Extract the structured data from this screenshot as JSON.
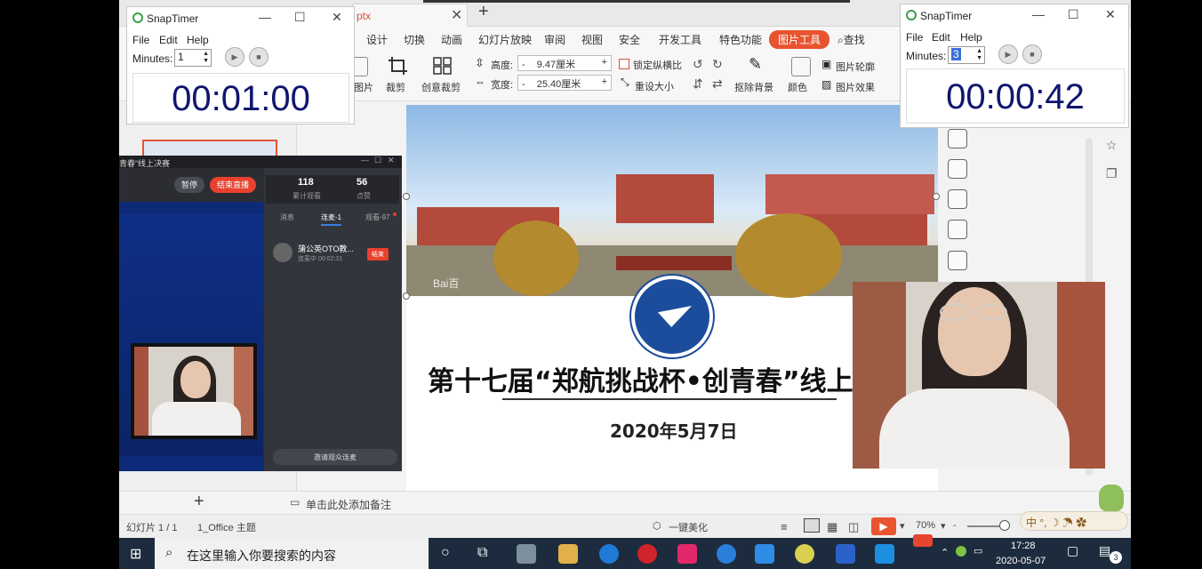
{
  "document_tab": {
    "title": "ptx",
    "add": "+"
  },
  "menu": {
    "items": [
      "设计",
      "切换",
      "动画",
      "幻灯片放映",
      "审阅",
      "视图",
      "安全",
      "开发工具",
      "特色功能"
    ],
    "active": "图片工具",
    "search": "查找"
  },
  "toolbar": {
    "image_label": "图片",
    "crop_label": "裁剪",
    "creative_crop_label": "创意裁剪",
    "height_label": "高度:",
    "height_value": "9.47厘米",
    "width_label": "宽度:",
    "width_value": "25.40厘米",
    "lock_ratio_label": "锁定纵横比",
    "reset_size_label": "重设大小",
    "remove_bg_label": "抠除背景",
    "color_label": "颜色",
    "outline_label": "图片轮廓",
    "effect_label": "图片效果",
    "minus": "-",
    "plus": "+"
  },
  "slide": {
    "title": "第十七届“郑航挑战杯•创青春”线上",
    "date": "2020年5月7日",
    "watermark": "Bai百"
  },
  "notes": {
    "add_slide": "+",
    "placeholder": "单击此处添加备注"
  },
  "statusbar": {
    "slide_index": "幻灯片 1 / 1",
    "theme": "1_Office 主题",
    "beautify": "一键美化",
    "zoom": "70%",
    "zoom_minus": "-",
    "zoom_plus": "+"
  },
  "live_panel": {
    "title": "青春”线上决赛",
    "pause": "暂停",
    "end_live": "结束直播",
    "stats": [
      {
        "value": "118",
        "label": "累计观看"
      },
      {
        "value": "56",
        "label": "点赞"
      }
    ],
    "tabs": [
      "消息",
      "连麦-1",
      "观看-97"
    ],
    "contact": {
      "name": "蒲公英OTO教...",
      "sub": "连麦中 00:02:31",
      "action": "结束"
    },
    "invite": "邀请观众连麦"
  },
  "snap_timer_left": {
    "title": "SnapTimer",
    "menu": [
      "File",
      "Edit",
      "Help"
    ],
    "minutes_label": "Minutes:",
    "minutes_value": "1",
    "time": "00:01:00",
    "minimize": "—",
    "maximize": "☐",
    "close": "✕"
  },
  "snap_timer_right": {
    "title": "SnapTimer",
    "menu": [
      "File",
      "Edit",
      "Help"
    ],
    "minutes_label": "Minutes:",
    "minutes_value": "3",
    "time": "00:00:42",
    "minimize": "—",
    "maximize": "☐",
    "close": "✕"
  },
  "taskbar": {
    "search_placeholder": "在这里输入你要搜索的内容",
    "time": "17:28",
    "date": "2020-05-07",
    "ime_text": "中 °, ☽ ☂ ✿",
    "notif_count": "3"
  },
  "colors": {
    "accent": "#e8542f",
    "timer_text": "#10166e",
    "live_blue": "#0d2a78",
    "taskbar": "#1d2b3e"
  }
}
